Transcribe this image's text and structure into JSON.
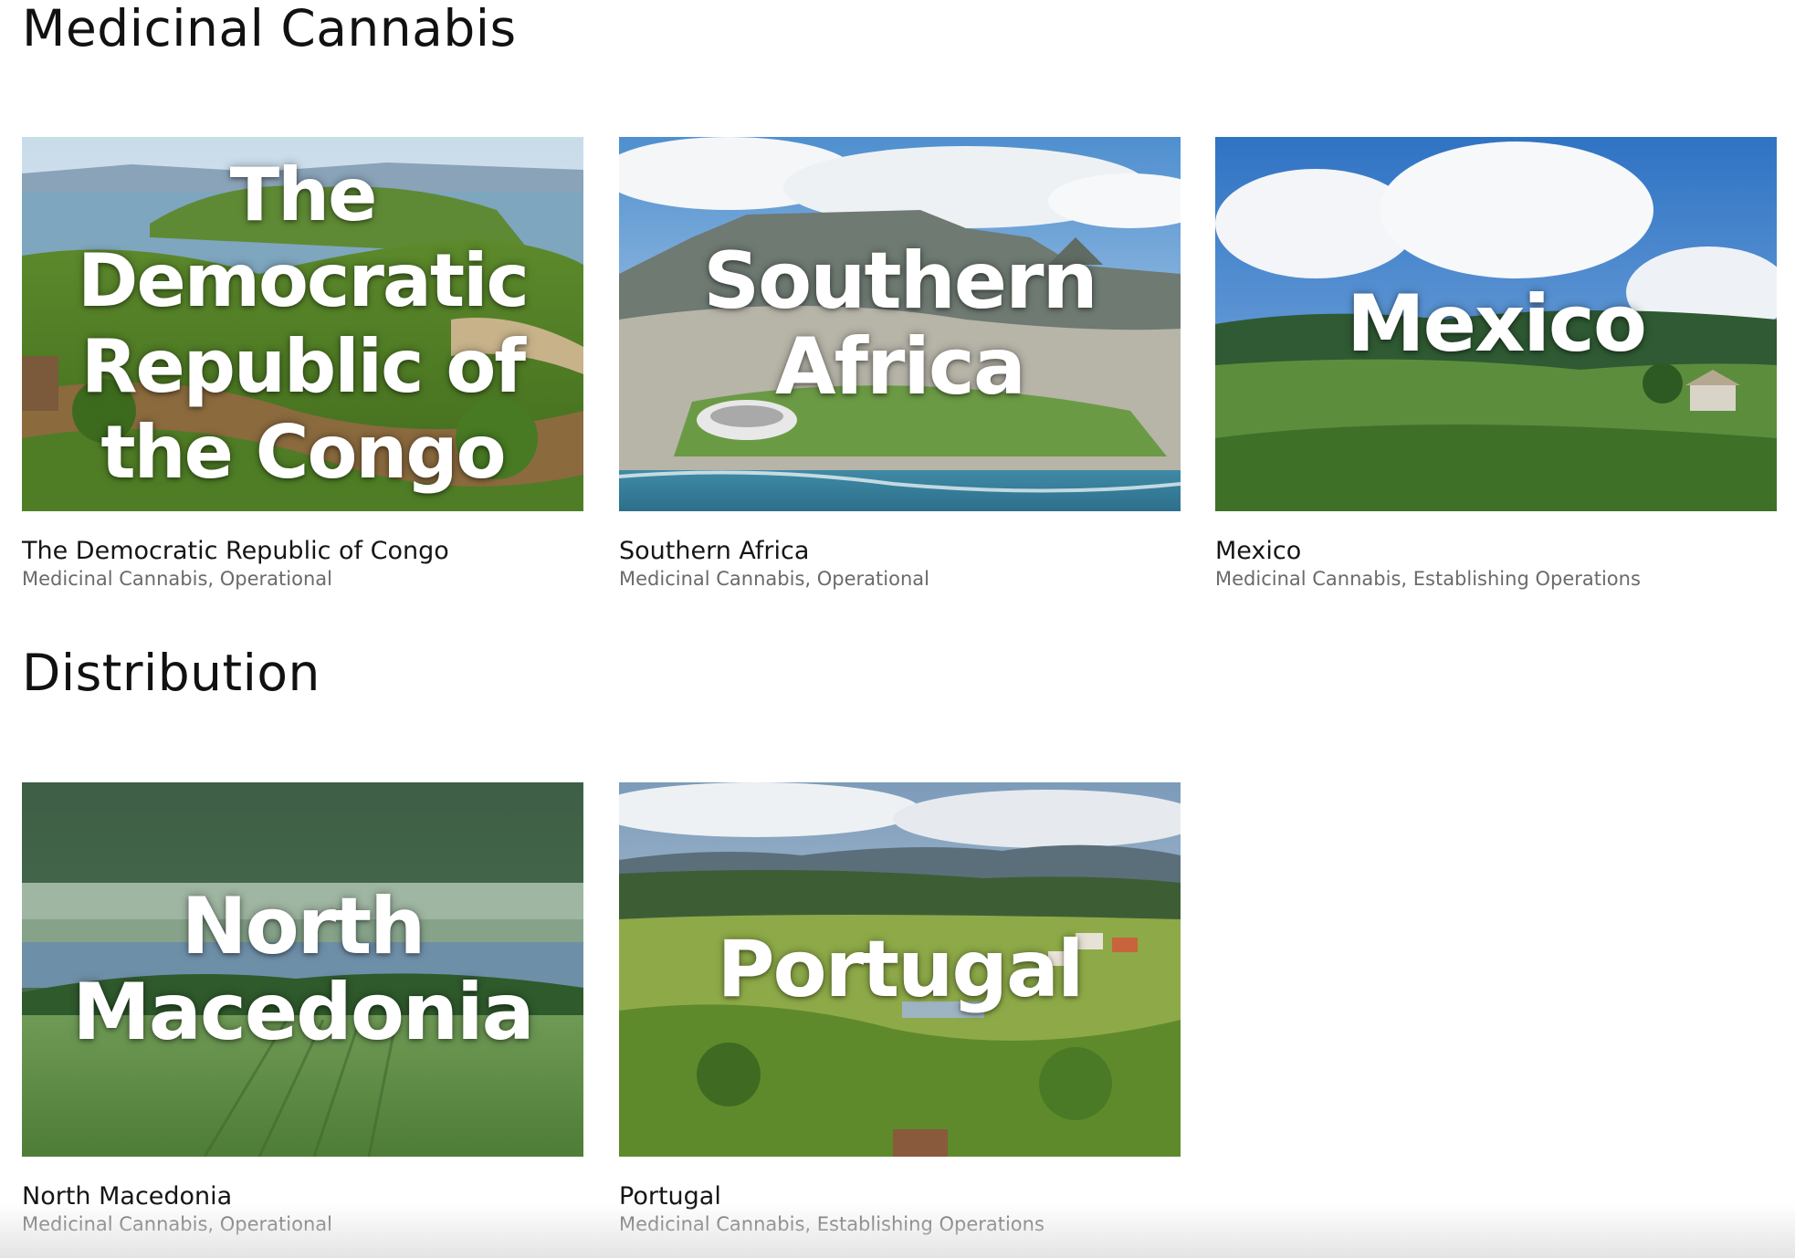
{
  "sections": [
    {
      "title": "Medicinal Cannabis",
      "cards": [
        {
          "overlay": "The\nDemocratic\nRepublic of\nthe Congo",
          "name": "The Democratic Republic of Congo",
          "meta": "Medicinal Cannabis, Operational"
        },
        {
          "overlay": "Southern\nAfrica",
          "name": "Southern Africa",
          "meta": "Medicinal Cannabis, Operational"
        },
        {
          "overlay": "Mexico",
          "name": "Mexico",
          "meta": "Medicinal Cannabis, Establishing Operations"
        }
      ]
    },
    {
      "title": "Distribution",
      "cards": [
        {
          "overlay": "North\nMacedonia",
          "name": "North Macedonia",
          "meta": "Medicinal Cannabis, Operational"
        },
        {
          "overlay": "Portugal",
          "name": "Portugal",
          "meta": "Medicinal Cannabis, Establishing Operations"
        }
      ]
    }
  ],
  "colors": {
    "heading": "#111111",
    "card_title": "#151515",
    "card_meta": "#6a6a6a",
    "overlay_text": "#ffffff"
  }
}
